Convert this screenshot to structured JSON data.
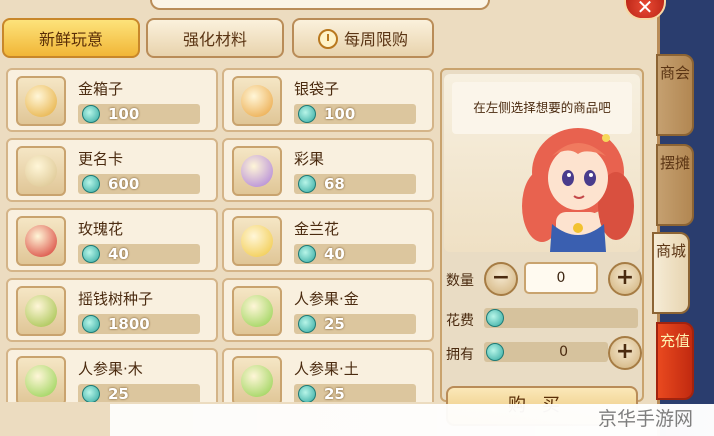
{
  "tabs": [
    {
      "label": "新鲜玩意"
    },
    {
      "label": "强化材料"
    },
    {
      "label": "每周限购"
    }
  ],
  "items": [
    {
      "name": "金箱子",
      "price": "100",
      "icon": "gold-chest-icon",
      "color": "#e4a934"
    },
    {
      "name": "银袋子",
      "price": "100",
      "icon": "silver-bag-icon",
      "color": "#e9a13a"
    },
    {
      "name": "更名卡",
      "price": "600",
      "icon": "scroll-quill-icon",
      "color": "#d8c08a"
    },
    {
      "name": "彩果",
      "price": "68",
      "icon": "rainbow-fruit-icon",
      "color": "#a97bd9"
    },
    {
      "name": "玫瑰花",
      "price": "40",
      "icon": "rose-icon",
      "color": "#d4312a"
    },
    {
      "name": "金兰花",
      "price": "40",
      "icon": "orchid-icon",
      "color": "#f0c63d"
    },
    {
      "name": "摇钱树种子",
      "price": "1800",
      "icon": "money-seed-icon",
      "color": "#9bbd3f"
    },
    {
      "name": "人参果·金",
      "price": "25",
      "icon": "ginseng-fruit-icon",
      "color": "#8fcf4a"
    },
    {
      "name": "人参果·木",
      "price": "25",
      "icon": "ginseng-fruit-icon",
      "color": "#8fcf4a"
    },
    {
      "name": "人参果·土",
      "price": "25",
      "icon": "ginseng-fruit-icon",
      "color": "#8fcf4a"
    }
  ],
  "detail": {
    "hint": "在左侧选择想要的商品吧",
    "qty_label": "数量",
    "qty_value": "0",
    "cost_label": "花费",
    "own_label": "拥有",
    "own_value": "0",
    "buy_label": "购买"
  },
  "side_tabs": [
    {
      "label": "商会"
    },
    {
      "label": "摆摊"
    },
    {
      "label": "商城"
    },
    {
      "label": "充值"
    }
  ],
  "watermark": "京华手游网",
  "close_label": "✕"
}
